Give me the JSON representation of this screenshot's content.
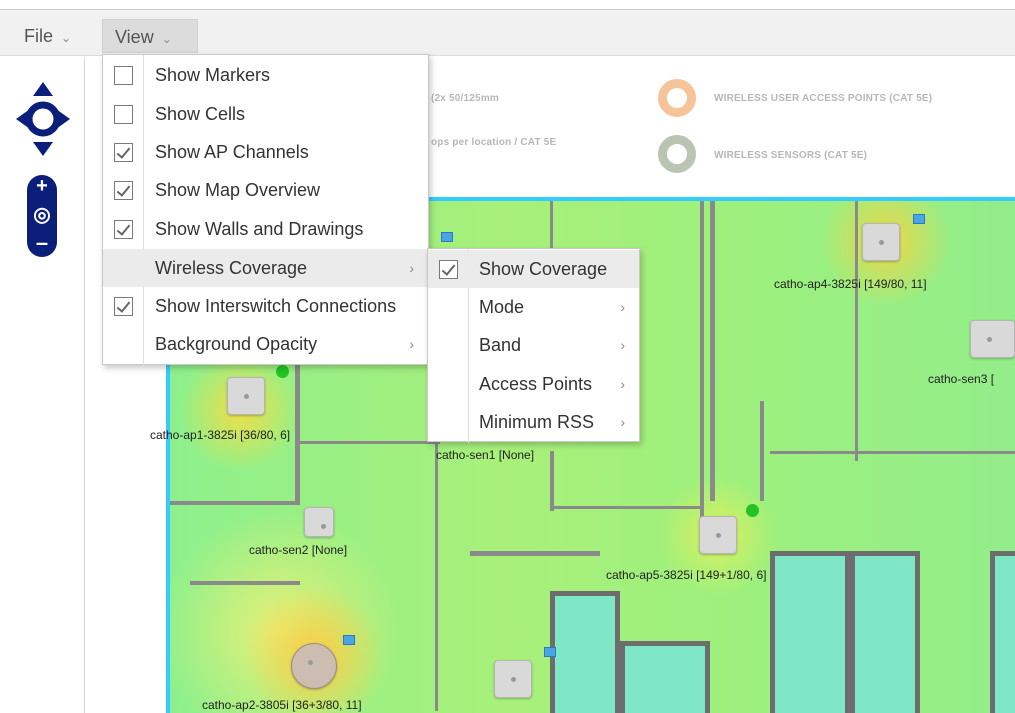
{
  "menubar": {
    "file": "File",
    "view": "View"
  },
  "view_menu": {
    "items": [
      {
        "label": "Show Markers",
        "checked": false
      },
      {
        "label": "Show Cells",
        "checked": false
      },
      {
        "label": "Show AP Channels",
        "checked": true
      },
      {
        "label": "Show Map Overview",
        "checked": true
      },
      {
        "label": "Show Walls and Drawings",
        "checked": true
      },
      {
        "label": "Wireless Coverage",
        "submenu": true
      },
      {
        "label": "Show Interswitch Connections",
        "checked": true
      },
      {
        "label": "Background Opacity",
        "submenu": true
      }
    ]
  },
  "coverage_submenu": {
    "items": [
      {
        "label": "Show Coverage",
        "checked": true
      },
      {
        "label": "Mode",
        "submenu": true
      },
      {
        "label": "Band",
        "submenu": true
      },
      {
        "label": "Access Points",
        "submenu": true
      },
      {
        "label": "Minimum RSS",
        "submenu": true
      }
    ]
  },
  "legend": {
    "cable_text": "(2x 50/125mm",
    "drops_text": "ops per location / CAT 5E",
    "wap": "WIRELESS USER ACCESS POINTS (CAT 5E)",
    "sensors": "WIRELESS SENSORS (CAT 5E)",
    "wap_color": "#f7a85a",
    "sensor_color": "#9fae97"
  },
  "access_points": [
    {
      "label": "catho-ap1-3825i [36/80, 6]"
    },
    {
      "label": "catho-sen1 [None]"
    },
    {
      "label": "catho-sen2 [None]"
    },
    {
      "label": "catho-ap2-3805i [36+3/80, 11]"
    },
    {
      "label": "catho-ap4-3825i [149/80, 11]"
    },
    {
      "label": "catho-sen3 ["
    },
    {
      "label": "catho-ap5-3825i [149+1/80, 6]"
    }
  ],
  "colors": {
    "coverage_green": "#9cf07e",
    "floor_border": "#33ccff",
    "zoom_control": "#0b1f7a"
  }
}
